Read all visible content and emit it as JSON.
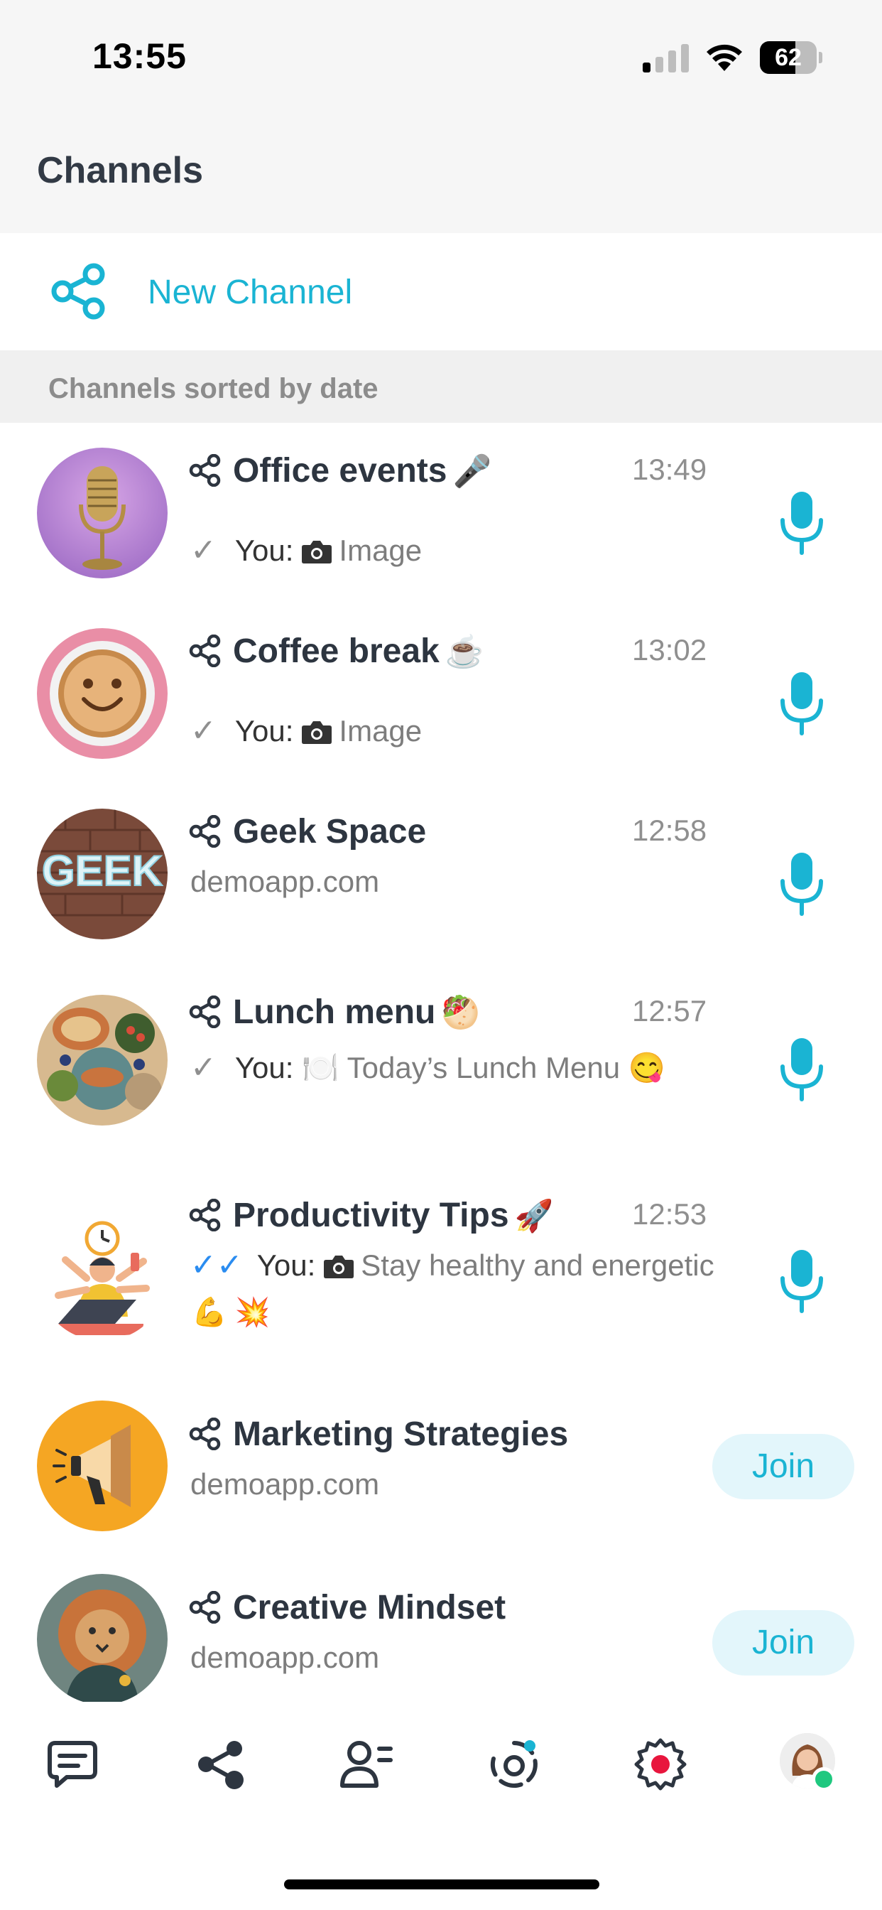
{
  "status_bar": {
    "time": "13:55",
    "battery_level": "62",
    "battery_fraction": 0.62
  },
  "header": {
    "title": "Channels"
  },
  "new_channel": {
    "label": "New Channel",
    "icon": "share-icon"
  },
  "section": {
    "label": "Channels sorted by date"
  },
  "channels": [
    {
      "name": "Office events",
      "emoji": "🎤",
      "time": "13:49",
      "tick": "✓",
      "you_label": "You:",
      "has_camera": true,
      "preview": "Image",
      "action": "mic-icon",
      "avatar": "microphone-photo"
    },
    {
      "name": "Coffee break",
      "emoji": "☕",
      "time": "13:02",
      "tick": "✓",
      "you_label": "You:",
      "has_camera": true,
      "preview": "Image",
      "action": "mic-icon",
      "avatar": "coffee-photo"
    },
    {
      "name": "Geek Space",
      "emoji": "",
      "time": "12:58",
      "subtitle": "demoapp.com",
      "action": "mic-icon",
      "avatar": "geek-neon-sign-photo"
    },
    {
      "name": "Lunch menu",
      "emoji": "🥙",
      "time": "12:57",
      "tick": "✓",
      "you_label": "You:",
      "preview": "🍽️ Today’s Lunch Menu 😋",
      "action": "mic-icon",
      "avatar": "lunch-food-photo"
    },
    {
      "name": "Productivity Tips",
      "emoji": "🚀",
      "time": "12:53",
      "tick": "✓✓",
      "you_label": "You:",
      "has_camera": true,
      "preview": "Stay healthy and energetic",
      "preview_line2": "💪 💥",
      "action": "mic-icon",
      "avatar": "multitasking-illustration"
    },
    {
      "name": "Marketing Strategies",
      "emoji": "",
      "subtitle": "demoapp.com",
      "join_label": "Join",
      "avatar": "megaphone-icon"
    },
    {
      "name": "Creative Mindset",
      "emoji": "",
      "subtitle": "demoapp.com",
      "join_label": "Join",
      "avatar": "lion-art"
    }
  ],
  "tab_bar": {
    "tabs": [
      "chats-icon",
      "channels-icon",
      "contacts-icon",
      "stories-icon",
      "settings-icon",
      "profile-avatar"
    ]
  },
  "colors": {
    "accent": "#1ab4d3",
    "text_primary": "#2d3540",
    "text_secondary": "#7d7d7d",
    "section_bg": "#f0f0f0",
    "header_bg": "#f6f6f6",
    "join_bg": "#e3f6fb",
    "read_tick": "#2a8cf0",
    "online": "#1fc87f",
    "settings_dot": "#e8163d"
  }
}
